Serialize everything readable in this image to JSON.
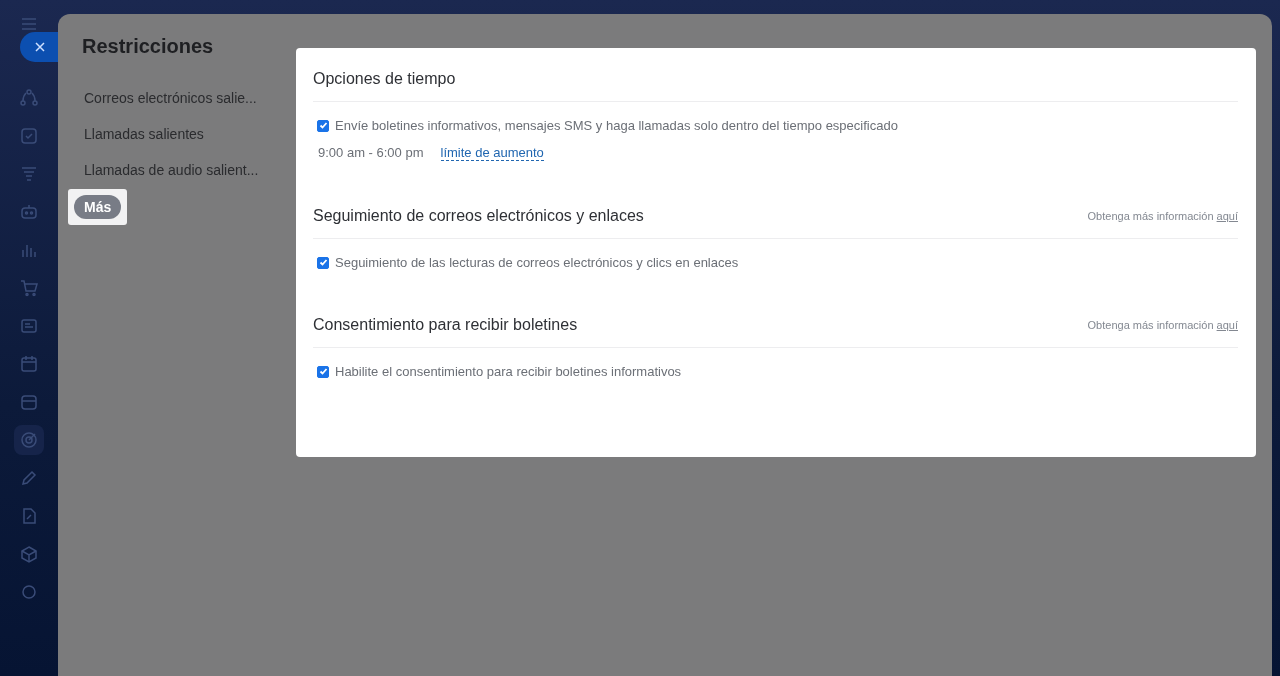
{
  "panel": {
    "title": "Restricciones"
  },
  "nav": [
    {
      "label": "Correos electrónicos salie...",
      "selected": false
    },
    {
      "label": "Llamadas salientes",
      "selected": false
    },
    {
      "label": "Llamadas de audio salient...",
      "selected": false
    }
  ],
  "more_button": "Más",
  "sections": [
    {
      "title": "Opciones de tiempo",
      "options": [
        {
          "kind": "checkbox",
          "label": "Envíe boletines informativos, mensajes SMS y haga llamadas solo dentro del tiempo especificado",
          "checked": true
        },
        {
          "kind": "time",
          "value": "9:00 am - 6:00 pm",
          "link": "límite de aumento"
        }
      ]
    },
    {
      "title": "Seguimiento de correos electrónicos y enlaces",
      "info": {
        "text": "Obtenga más información",
        "link": "aquí"
      },
      "options": [
        {
          "kind": "checkbox",
          "label": "Seguimiento de las lecturas de correos electrónicos y clics en enlaces",
          "checked": true
        }
      ]
    },
    {
      "title": "Consentimiento para recibir boletines",
      "info": {
        "text": "Obtenga más información",
        "link": "aquí"
      },
      "options": [
        {
          "kind": "checkbox",
          "label": "Habilite el consentimiento para recibir boletines informativos",
          "checked": true
        }
      ]
    }
  ]
}
